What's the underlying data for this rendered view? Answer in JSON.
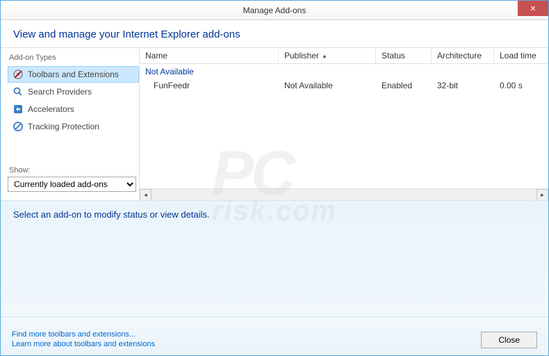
{
  "window": {
    "title": "Manage Add-ons",
    "close_x": "✕"
  },
  "header": {
    "title": "View and manage your Internet Explorer add-ons"
  },
  "sidebar": {
    "types_label": "Add-on Types",
    "items": [
      {
        "label": "Toolbars and Extensions",
        "selected": true
      },
      {
        "label": "Search Providers",
        "selected": false
      },
      {
        "label": "Accelerators",
        "selected": false
      },
      {
        "label": "Tracking Protection",
        "selected": false
      }
    ],
    "show_label": "Show:",
    "show_value": "Currently loaded add-ons"
  },
  "table": {
    "columns": {
      "name": "Name",
      "publisher": "Publisher",
      "status": "Status",
      "architecture": "Architecture",
      "loadtime": "Load time"
    },
    "group": "Not Available",
    "rows": [
      {
        "name": "FunFeedr",
        "publisher": "Not Available",
        "status": "Enabled",
        "architecture": "32-bit",
        "loadtime": "0.00 s"
      }
    ]
  },
  "detail": {
    "prompt": "Select an add-on to modify status or view details."
  },
  "footer": {
    "link1": "Find more toolbars and extensions...",
    "link2": "Learn more about toolbars and extensions",
    "close": "Close"
  },
  "scroll": {
    "left": "◄",
    "right": "►"
  }
}
